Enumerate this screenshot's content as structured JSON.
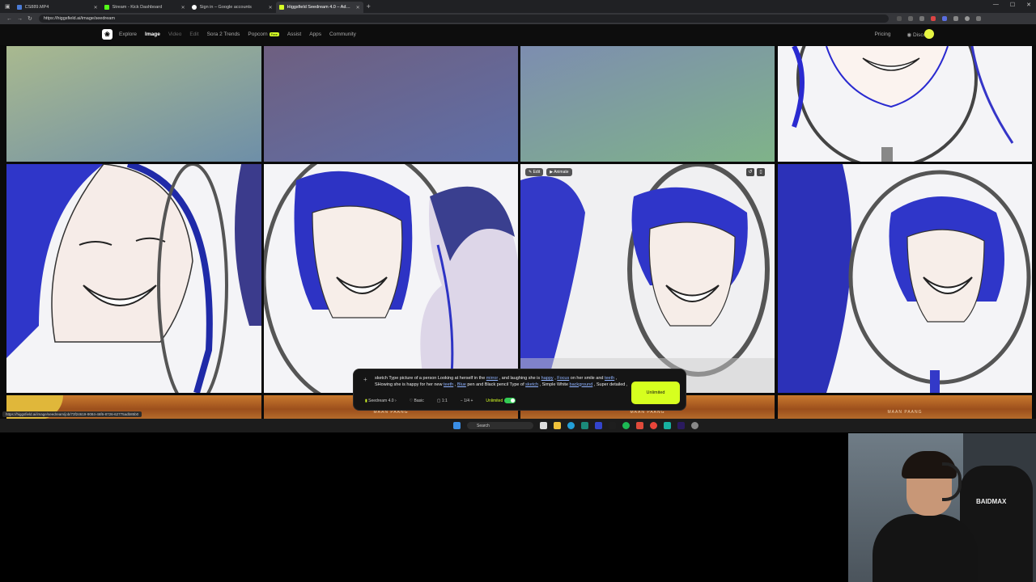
{
  "tabs": [
    {
      "title": "CS889.MP4",
      "color": "#4a7bd6",
      "active": false
    },
    {
      "title": "Stream - Kick Dashboard",
      "color": "#53fc18",
      "active": false
    },
    {
      "title": "Sign in – Google accounts",
      "color": "#ffffff",
      "active": false
    },
    {
      "title": "Higgsfield Seedream 4.0 – Advan",
      "color": "#d6ff26",
      "active": true
    }
  ],
  "url": "https://higgsfield.ai/image/seedream",
  "site_nav": {
    "items": [
      "Explore",
      "Image",
      "Video",
      "Edit",
      "Sora 2 Trends",
      "Popcorn",
      "Assist",
      "Apps",
      "Community"
    ],
    "active": "Image",
    "popcorn_badge": "Free",
    "pricing": "Pricing",
    "discord": "Discord"
  },
  "hover_actions": {
    "edit": "Edit",
    "animate": "Animate"
  },
  "wood_sign": "MAAN PAANG",
  "prompt": {
    "segments": [
      {
        "t": "sketch Type picture of a person Looking at herself in the ",
        "u": false
      },
      {
        "t": "mirror",
        "u": true
      },
      {
        "t": " , and laughing she is ",
        "u": false
      },
      {
        "t": "happy",
        "u": true
      },
      {
        "t": " , ",
        "u": false
      },
      {
        "t": "Focus",
        "u": true
      },
      {
        "t": " on her smile and ",
        "u": false
      },
      {
        "t": "teeth",
        "u": true
      },
      {
        "t": " , SHowing she is happy for her new ",
        "u": false
      },
      {
        "t": "teeth",
        "u": true
      },
      {
        "t": " , ",
        "u": false
      },
      {
        "t": "Blue",
        "u": true
      },
      {
        "t": " pen and Black pencil Type of ",
        "u": false
      },
      {
        "t": "sketch",
        "u": true
      },
      {
        "t": " , Simple White ",
        "u": false
      },
      {
        "t": "background",
        "u": true
      },
      {
        "t": " , Super detailed ,",
        "u": false
      }
    ],
    "model": "Seedream 4.0",
    "quality": "Basic",
    "aspect": "1:1",
    "count": "1/4",
    "unlimited_label": "Unlimited",
    "unlimited_on": true,
    "generate_label": "Unlimited"
  },
  "status_url": "https://higgsfield.ai/image/seedream/job/73f24619-9084-46f6-8726-62775adb85b0",
  "taskbar": {
    "search_placeholder": "Search"
  },
  "webcam": {
    "chair_brand": "BAIDMAX"
  }
}
